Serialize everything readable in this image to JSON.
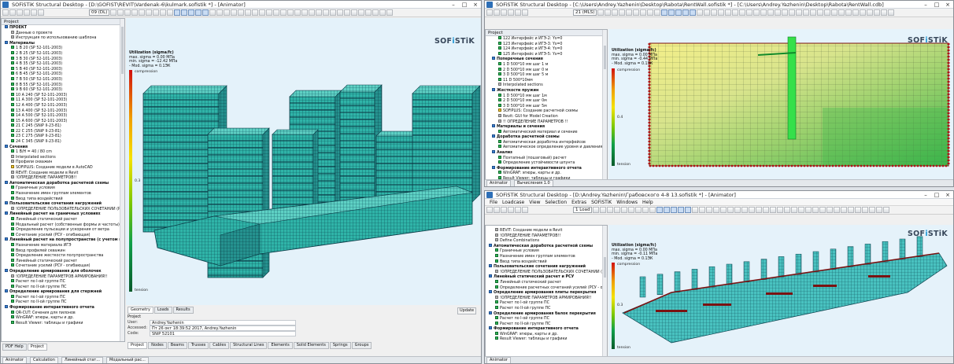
{
  "logo": {
    "main": "SOF",
    "accent": "i",
    "rest": "STiK"
  },
  "w1": {
    "title": "SOFiSTiK Structural Desktop - [D:\\GOFIST\\REVIT\\Vardenak-6\\kulmark.sofistik *] - [Animator]",
    "scheme": "09 (DL)",
    "tree_header": "Project",
    "tree": [
      {
        "t": "ПРОЕКТ",
        "b": true,
        "c": "blue"
      },
      {
        "t": "Данные о проекте",
        "c": "grey"
      },
      {
        "t": "Инструкция по использованию шаблона",
        "c": "grey"
      },
      {
        "t": "Материалы",
        "b": true,
        "c": "blue"
      },
      {
        "t": "1 В 20 (SP 52-101-2003)",
        "c": "g"
      },
      {
        "t": "2 В 25 (SP 52-101-2003)",
        "c": "g"
      },
      {
        "t": "3 В 30 (SP 52-101-2003)",
        "c": "g"
      },
      {
        "t": "4 В 35 (SP 52-101-2003)",
        "c": "g"
      },
      {
        "t": "5 В 40 (SP 52-101-2003)",
        "c": "g"
      },
      {
        "t": "6 В 45 (SP 52-101-2003)",
        "c": "g"
      },
      {
        "t": "7 В 50 (SP 52-101-2003)",
        "c": "g"
      },
      {
        "t": "8 В 55 (SP 52-101-2003)",
        "c": "g"
      },
      {
        "t": "9 В 60 (SP 52-101-2003)",
        "c": "g"
      },
      {
        "t": "10 A 240 (SP 52-101-2003)",
        "c": "g"
      },
      {
        "t": "11 A 300 (SP 52-101-2003)",
        "c": "g"
      },
      {
        "t": "12 A 400 (SP 52-101-2003)",
        "c": "g"
      },
      {
        "t": "13 A 400 (SP 52-101-2003)",
        "c": "g"
      },
      {
        "t": "14 A 500 (SP 52-101-2003)",
        "c": "g"
      },
      {
        "t": "15 A 600 (SP 52-101-2003)",
        "c": "g"
      },
      {
        "t": "21 C 245 (SNiP II-23-81)",
        "c": "g"
      },
      {
        "t": "22 C 255 (SNiP II-23-81)",
        "c": "g"
      },
      {
        "t": "23 C 275 (SNiP II-23-81)",
        "c": "g"
      },
      {
        "t": "24 C 345 (SNiP II-23-81)",
        "c": "g"
      },
      {
        "t": "Сечения",
        "b": true,
        "c": "blue"
      },
      {
        "t": "1 B/H = 40 / 80 cm",
        "c": "g"
      },
      {
        "t": "Interpolated sections",
        "c": "grey"
      },
      {
        "t": "Профили скважин",
        "c": "grey"
      },
      {
        "t": "SOFiPLUS: Создание модели в AutoCAD",
        "c": "yel"
      },
      {
        "t": "REVIT: Создание модели в Revit",
        "c": "grey"
      },
      {
        "t": "!ОПРЕДЕЛЕНИЕ ПАРАМЕТРОВ!!",
        "c": "grey"
      },
      {
        "t": "Автоматическая доработка расчетной схемы",
        "b": true,
        "c": "blue"
      },
      {
        "t": "Граничные условия",
        "c": "g"
      },
      {
        "t": "Назначение имен группам элементов",
        "c": "g"
      },
      {
        "t": "Ввод типа воздействий",
        "c": "g"
      },
      {
        "t": "Пользовательские сочетания нагружений",
        "b": true,
        "c": "blue"
      },
      {
        "t": "!ОПРЕДЕЛЕНИЕ ПОЛЬЗОВАТЕЛЬСКИХ СОЧЕТАНИЙ (РСН)!!",
        "c": "grey"
      },
      {
        "t": "Линейный расчет на граничных условиях",
        "b": true,
        "c": "blue"
      },
      {
        "t": "Линейный статический расчет",
        "c": "g"
      },
      {
        "t": "Модальный расчет (собственные формы и частоты)",
        "c": "g"
      },
      {
        "t": "Определение пульсации и ускорения от ветра",
        "c": "g"
      },
      {
        "t": "Сочетание усилий (РСУ - огибающая)",
        "c": "g"
      },
      {
        "t": "Линейный расчет на полупространстве (с учетом грунта)",
        "b": true,
        "c": "blue"
      },
      {
        "t": "Назначение материала ИГЭ",
        "c": "g"
      },
      {
        "t": "Ввод профилей скважин",
        "c": "g"
      },
      {
        "t": "Определение жесткости полупространства",
        "c": "g"
      },
      {
        "t": "Линейный статический расчет",
        "c": "g"
      },
      {
        "t": "Сочетание усилий (РСУ - огибающая)",
        "c": "g"
      },
      {
        "t": "Определение армирования для оболочек",
        "b": true,
        "c": "blue"
      },
      {
        "t": "!ОПРЕДЕЛЕНИЕ ПАРАМЕТРОВ АРМИРОВАНИЯ!!",
        "c": "grey"
      },
      {
        "t": "Расчет по I-ой группе ПС",
        "c": "g"
      },
      {
        "t": "Расчет по II-ой группе ПС",
        "c": "g"
      },
      {
        "t": "Определение армирования для стержней",
        "b": true,
        "c": "blue"
      },
      {
        "t": "Расчет по I-ой группе ПС",
        "c": "g"
      },
      {
        "t": "Расчет по II-ой группе ПС",
        "c": "g"
      },
      {
        "t": "Формирование интерактивного отчета",
        "b": true,
        "c": "blue"
      },
      {
        "t": "QR-CUT: Сечения для пилонов",
        "c": "g"
      },
      {
        "t": "WinGRAF: эпюры, карты и др.",
        "c": "g"
      },
      {
        "t": "Result Viewer: таблицы и графики",
        "c": "g"
      }
    ],
    "legend": {
      "title": "Utilization (sigma/fc)",
      "l1": "max. sigma = 0.00 МПа",
      "l2": "min. sigma = -12.42 МПа",
      "l3": "- Mod. sigma = 0.1ЭК",
      "top": "compression",
      "mid": "0.3",
      "bot": "tension"
    },
    "tabs": [
      "Geometry",
      "Loads",
      "Results"
    ],
    "props": {
      "header": "Project",
      "user_k": "User:",
      "user_v": "Andrey.Yazhenin",
      "acc_k": "Accessed:",
      "acc_v": "Пт 26 окт 18:39:52 2017, Andrey.Yazhenin",
      "code_k": "Code:",
      "code_v": "SNiP 52101"
    },
    "update": "Update",
    "bottom_tabs": [
      "Project",
      "Nodes",
      "Beams",
      "Trusses",
      "Cables",
      "Structural Lines",
      "Elements",
      "Solid Elements",
      "Springs",
      "Groups"
    ],
    "left_tabs": [
      "PDF Help",
      "Project"
    ],
    "status": [
      "Animator",
      "Calculation",
      "Линейный стат...",
      "Модальный рас..."
    ]
  },
  "w2": {
    "title": "SOFiSTiK Structural Desktop - [C:\\Users\\Andrey.Yazhenin\\Desktop\\Rabota\\RentWall.sofistik *] - [C:\\Users\\Andrey.Yazhenin\\Desktop\\Rabota\\RentWall.cdb]",
    "scheme": "21 (MLS)",
    "tree_header": "Project",
    "tree": [
      {
        "t": "122 Интерфейс и ИГЭ-2: Ys=0",
        "c": "g"
      },
      {
        "t": "123 Интерфейс и ИГЭ-3: Ys=0",
        "c": "g"
      },
      {
        "t": "124 Интерфейс и ИГЭ-4: Ys=0",
        "c": "g"
      },
      {
        "t": "125 Интерфейс и ИГЭ-5: Ys=0",
        "c": "g"
      },
      {
        "t": "Поперечные сечения",
        "b": true,
        "c": "blue"
      },
      {
        "t": "1 D 500*10 мм шаг 1 м",
        "c": "g"
      },
      {
        "t": "2 D 500*10 мм шаг 0 м",
        "c": "g"
      },
      {
        "t": "3 D 500*10 мм шаг 5 м",
        "c": "g"
      },
      {
        "t": "11 D 500*10мм",
        "c": "g"
      },
      {
        "t": "Interpolated sections",
        "c": "grey"
      },
      {
        "t": "Жесткости пружин",
        "b": true,
        "c": "blue"
      },
      {
        "t": "1 D 500*10 мм шаг 1м",
        "c": "g"
      },
      {
        "t": "2 D 500*10 мм шаг 0м",
        "c": "g"
      },
      {
        "t": "3 D 500*10 мм шаг 5м",
        "c": "g"
      },
      {
        "t": "SOFiPLUS: Создание расчетной схемы",
        "c": "yel"
      },
      {
        "t": "Revit: GUI for Model Creation",
        "c": "grey"
      },
      {
        "t": "!! ОПРЕДЕЛЕНИЕ ПАРАМЕТРОВ !!",
        "c": "grey"
      },
      {
        "t": "Материалы и сечения",
        "b": true,
        "c": "blue"
      },
      {
        "t": "Автоматический материал и сечение",
        "c": "g"
      },
      {
        "t": "Доработка расчетной схемы",
        "b": true,
        "c": "blue"
      },
      {
        "t": "Автоматическая доработка интерфейсов",
        "c": "g"
      },
      {
        "t": "Автоматическое определение уровня и давления воды",
        "c": "g"
      },
      {
        "t": "Анализ",
        "b": true,
        "c": "blue"
      },
      {
        "t": "Поэтапный (пошаговый) расчет",
        "c": "g"
      },
      {
        "t": "Определение устойчивости шпунта",
        "c": "g"
      },
      {
        "t": "Формирование интерактивного отчета",
        "b": true,
        "c": "blue"
      },
      {
        "t": "WinGRAF: эпюры, карты и др.",
        "c": "g"
      },
      {
        "t": "Result Viewer: таблицы и графики",
        "c": "g"
      }
    ],
    "legend": {
      "title": "Utilization (sigma/fc)",
      "l1": "max. sigma = 0.00 МПа",
      "l2": "min. sigma = -0.44 МПа",
      "l3": "- Mod. sigma = 0.1ЭК",
      "top": "compression",
      "mid": "0.4",
      "bot": "tension"
    },
    "status": [
      "Animator",
      "Вычисления 1.0"
    ]
  },
  "w3": {
    "title": "SOFiSTiK Structural Desktop - [D:\\Andrey.Yazhenin\\Грабовского 4-8 13.sofistik *] - [Animator]",
    "menu": [
      "File",
      "Loadcase",
      "View",
      "Selection",
      "Extras",
      "SOFiSTiK",
      "Windows",
      "Help"
    ],
    "scheme": "1 Load",
    "tree": [
      {
        "t": "REVIT: Создание модели в Revit",
        "c": "grey"
      },
      {
        "t": "!ОПРЕДЕЛЕНИЕ ПАРАМЕТРОВ!!",
        "c": "grey"
      },
      {
        "t": "Define Combinations",
        "c": "grey"
      },
      {
        "t": "Автоматическая доработка расчетной схемы",
        "b": true,
        "c": "blue"
      },
      {
        "t": "Граничные условия",
        "c": "g"
      },
      {
        "t": "Назначение имен группам элементов",
        "c": "g"
      },
      {
        "t": "Ввод типа воздействий",
        "c": "g"
      },
      {
        "t": "Пользовательские сочетания нагружений",
        "b": true,
        "c": "blue"
      },
      {
        "t": "!ОПРЕДЕЛЕНИЕ ПОЛЬЗОВАТЕЛЬСКИХ СОЧЕТАНИЙ (Р...",
        "c": "grey"
      },
      {
        "t": "Линейный статический расчет и РСУ",
        "b": true,
        "c": "blue"
      },
      {
        "t": "Линейный статический расчет",
        "c": "g"
      },
      {
        "t": "Определение расчетных сочетаний усилий (РСУ - огиба...",
        "c": "g"
      },
      {
        "t": "Определение армирования плиты перекрытия",
        "b": true,
        "c": "blue"
      },
      {
        "t": "!ОПРЕДЕЛЕНИЕ ПАРАМЕТРОВ АРМИРОВАНИЯ!!",
        "c": "grey"
      },
      {
        "t": "Расчет по I-ой группе ПС",
        "c": "g"
      },
      {
        "t": "Расчет по II-ой группе ПС",
        "c": "g"
      },
      {
        "t": "Определение армирования балок перекрытия",
        "b": true,
        "c": "blue"
      },
      {
        "t": "Расчет по I-ой группе ПС",
        "c": "g"
      },
      {
        "t": "Расчет по II-ой группе ПС",
        "c": "g"
      },
      {
        "t": "Формирование интерактивного отчета",
        "b": true,
        "c": "blue"
      },
      {
        "t": "WinGRAF: эпюры, карты и др.",
        "c": "g"
      },
      {
        "t": "Result Viewer: таблицы и графики",
        "c": "g"
      }
    ],
    "legend": {
      "title": "Utilization (sigma/fc)",
      "l1": "max. sigma = 0.00 МПа",
      "l2": "min. sigma = -0.11 МПа",
      "l3": "- Mod. sigma = 0.1ЭК",
      "top": "compression",
      "mid": "0.3",
      "bot": "tension"
    },
    "status": [
      "Animator"
    ]
  }
}
